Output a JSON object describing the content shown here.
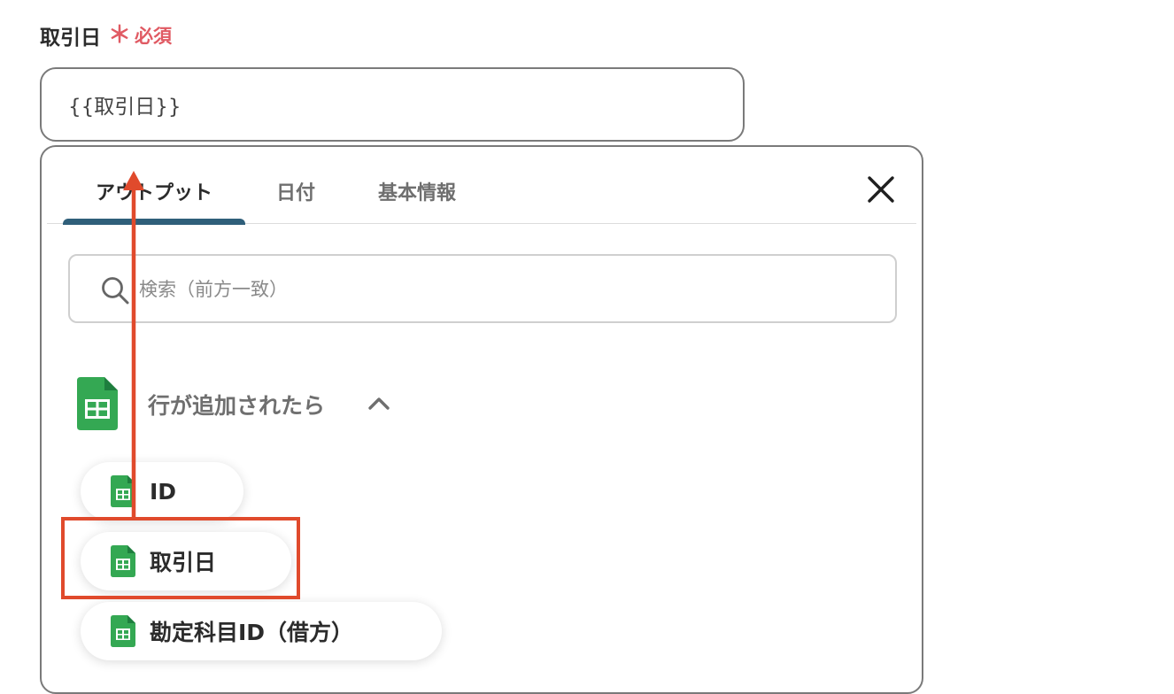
{
  "field": {
    "label": "取引日",
    "required_star": "＊",
    "required_text": "必須",
    "value": "{{取引日}}"
  },
  "picker": {
    "tabs": [
      {
        "label": "アウトプット",
        "active": true
      },
      {
        "label": "日付",
        "active": false
      },
      {
        "label": "基本情報",
        "active": false
      }
    ],
    "search_placeholder": "検索（前方一致）",
    "group": {
      "title": "行が追加されたら",
      "expanded": true,
      "items": [
        {
          "label": "ID"
        },
        {
          "label": "取引日",
          "highlighted": true
        },
        {
          "label": "勘定科目ID（借方）"
        }
      ]
    }
  },
  "colors": {
    "required": "#e05a63",
    "tab_indicator": "#2f5f7a",
    "annotation": "#e04a2c",
    "sheets_green": "#34a853"
  },
  "icons": {
    "close": "close-icon",
    "search": "search-icon",
    "chevron": "chevron-up-icon",
    "sheets": "google-sheets-icon"
  }
}
